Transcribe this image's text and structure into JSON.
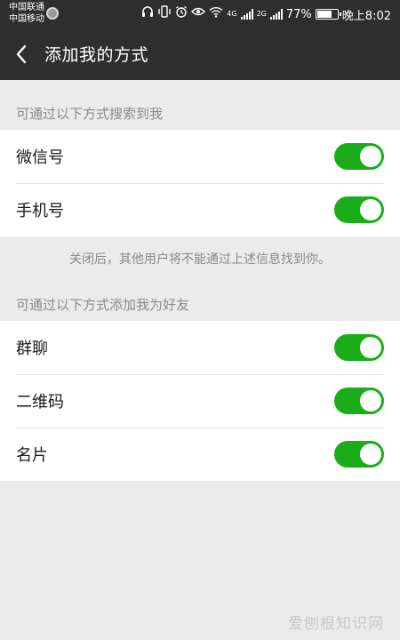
{
  "status_bar": {
    "carrier1": "中国联通",
    "carrier2": "中国移动",
    "net1": "4G",
    "net2": "2G",
    "battery": "77%",
    "battery_level": 0.77,
    "time": "晚上8:02",
    "icons": [
      "headphones-icon",
      "vibrate-icon",
      "alarm-icon",
      "eye-icon",
      "wifi-icon",
      "signal-icon",
      "battery-icon"
    ]
  },
  "header": {
    "title": "添加我的方式"
  },
  "section1": {
    "header": "可通过以下方式搜索到我",
    "items": [
      {
        "label": "微信号",
        "enabled": true
      },
      {
        "label": "手机号",
        "enabled": true
      }
    ],
    "note": "关闭后，其他用户将不能通过上述信息找到你。"
  },
  "section2": {
    "header": "可通过以下方式添加我为好友",
    "items": [
      {
        "label": "群聊",
        "enabled": true
      },
      {
        "label": "二维码",
        "enabled": true
      },
      {
        "label": "名片",
        "enabled": true
      }
    ]
  },
  "watermark": "爱刨根知识网",
  "colors": {
    "topbar": "#2e2e2e",
    "toggle_on": "#1aad19",
    "background": "#ebebeb"
  }
}
